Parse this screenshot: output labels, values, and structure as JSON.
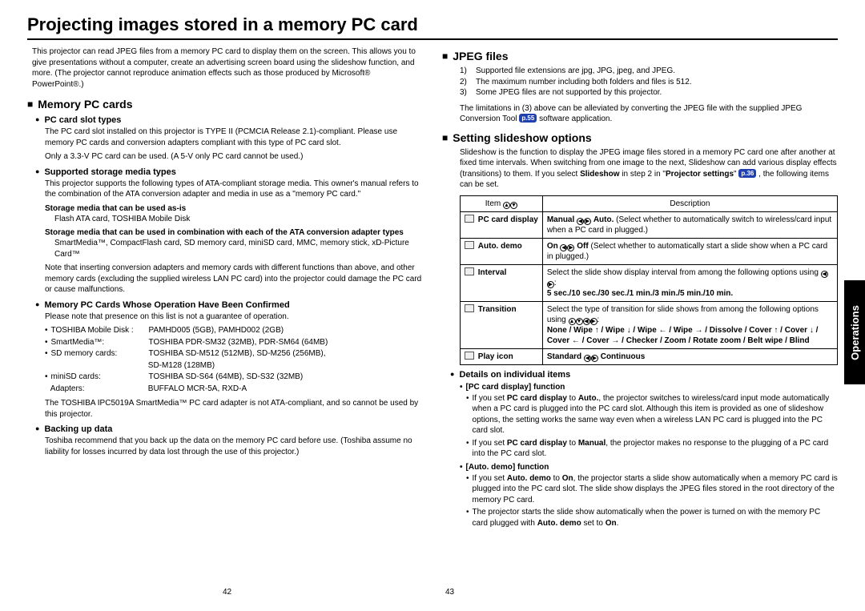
{
  "title": "Projecting images stored in a memory PC card",
  "intro": "This projector can read JPEG files from a memory PC card to display them on the screen. This allows you to give presentations without a computer, create an advertising screen board using the slideshow function, and more. (The projector cannot reproduce animation effects such as those produced by Microsoft® PowerPoint®.)",
  "sections": {
    "memory": "Memory PC cards",
    "jpeg": "JPEG files",
    "slideshow": "Setting slideshow options"
  },
  "sub": {
    "slot": "PC card slot types",
    "storage": "Supported storage media types",
    "confirmed": "Memory PC Cards Whose Operation Have Been Confirmed",
    "backup": "Backing up data",
    "details": "Details on individual items"
  },
  "slot_text": "The PC card slot installed on this projector is TYPE II (PCMCIA Release 2.1)-compliant. Please use memory PC cards and conversion adapters compliant with this type of PC card slot.",
  "slot_note": "Only a 3.3-V PC card can be used. (A 5-V only PC card cannot be used.)",
  "storage_text": "This projector supports the following types of ATA-compliant storage media. This owner's manual refers to the combination of the ATA conversion adapter and media in use as a \"memory PC card.\"",
  "storage_asis_title": "Storage media that can be used as-is",
  "storage_asis_body": "Flash ATA card, TOSHIBA Mobile Disk",
  "storage_combo_title": "Storage media that can be used in combination with each of the ATA conversion adapter types",
  "storage_combo_body": "SmartMedia™, CompactFlash card, SD memory card, miniSD card, MMC, memory stick, xD-Picture Card™",
  "storage_note": "Note that inserting conversion adapters and memory cards with different functions than above, and other memory cards (excluding the supplied wireless LAN PC card) into the projector could damage the PC card or cause malfunctions.",
  "confirmed_intro": "Please note that presence on this list is not a guarantee of operation.",
  "confirmed_rows": [
    {
      "label": "TOSHIBA Mobile Disk :",
      "value": "PAMHD005 (5GB), PAMHD002 (2GB)"
    },
    {
      "label": "SmartMedia™:",
      "value": "TOSHIBA PDR-SM32 (32MB), PDR-SM64 (64MB)"
    },
    {
      "label": "SD memory cards:",
      "value": "TOSHIBA SD-M512 (512MB), SD-M256 (256MB),"
    },
    {
      "label": "",
      "value": "SD-M128 (128MB)"
    },
    {
      "label": "miniSD cards:",
      "value": "TOSHIBA SD-S64 (64MB), SD-S32 (32MB)"
    },
    {
      "label": "Adapters:",
      "value": "BUFFALO MCR-5A, RXD-A"
    }
  ],
  "confirmed_note": "The TOSHIBA IPC5019A SmartMedia™ PC card adapter is not ATA-compliant, and so cannot be used by this projector.",
  "backup_text": "Toshiba recommend that you back up the data on the memory PC card before use. (Toshiba assume no liability for losses incurred by data lost through the use of this projector.)",
  "jpeg_list": [
    {
      "n": "1)",
      "t": "Supported file extensions are jpg, JPG, jpeg, and JPEG."
    },
    {
      "n": "2)",
      "t": "The maximum number including both folders and files is 512."
    },
    {
      "n": "3)",
      "t": "Some JPEG files are not supported by this projector."
    }
  ],
  "jpeg_post_a": "The limitations in (3) above can be alleviated by converting the JPEG file with the supplied JPEG Conversion Tool ",
  "jpeg_post_ref": "p.55",
  "jpeg_post_b": " software application.",
  "slideshow_intro_a": "Slideshow is the function to display the JPEG image files stored in a memory PC card one after another at fixed time intervals. When switching from one image to the next, Slideshow can add various display effects (transitions) to them. If you select ",
  "slideshow_intro_bold": "Slideshow",
  "slideshow_intro_b": " in step 2 in \"",
  "slideshow_intro_bold2": "Projector settings",
  "slideshow_intro_c": "\" ",
  "slideshow_intro_ref": "p.36",
  "slideshow_intro_d": " , the following items can be set.",
  "table": {
    "header_item": "Item",
    "header_desc": "Description",
    "rows": [
      {
        "item": "PC card display",
        "desc_html": "<b>Manual</b> <span class='arrowcircle'>◀</span><span class='arrowcircle'>▶</span> <b>Auto.</b>  (Select whether to automatically switch to wireless/card input when a PC card in plugged.)"
      },
      {
        "item": "Auto. demo",
        "desc_html": "<b>On</b> <span class='arrowcircle'>◀</span><span class='arrowcircle'>▶</span> <b>Off</b>  (Select whether to automatically start a slide show when a PC card in plugged.)"
      },
      {
        "item": "Interval",
        "desc_html": "Select the slide show display interval from among the following options using <span class='arrowcircle'>◀</span><span class='arrowcircle'>▶</span>:<br><b>5 sec./10 sec./30 sec./1 min./3 min./5 min./10 min.</b>"
      },
      {
        "item": "Transition",
        "desc_html": "Select the type of transition for slide shows from among the following options using <span class='arrowcircle'>▲</span><span class='arrowcircle'>▼</span><span class='arrowcircle'>◀</span><span class='arrowcircle'>▶</span>:<br><b>None / Wipe ↑  / Wipe ↓  / Wipe ←  / Wipe →  /  Dissolve / Cover ↑ / Cover ↓ / Cover ← / Cover → /   Checker / Zoom / Rotate zoom / Belt wipe / Blind</b>"
      },
      {
        "item": "Play icon",
        "desc_html": "<b>Standard</b> <span class='arrowcircle'>◀</span><span class='arrowcircle'>▶</span> <b>Continuous</b>"
      }
    ]
  },
  "details": {
    "pc_head": "[PC card display] function",
    "pc_items": [
      "If you set <b>PC card display</b> to <b>Auto.</b>, the projector switches to wireless/card input mode automatically when a PC card is plugged into the PC card slot. Although this item is provided as one of slideshow options, the setting works the same way even when a wireless LAN PC card is plugged into the PC card slot.",
      "If you set <b>PC card display</b> to <b>Manual</b>, the projector makes no response to the plugging of a PC card into the PC card slot."
    ],
    "auto_head": "[Auto. demo] function",
    "auto_items": [
      "If you set <b>Auto. demo</b> to <b>On</b>, the projector starts a slide show automatically when a memory PC card is plugged into the PC card slot. The slide show displays the JPEG files stored in the root directory of the memory PC card.",
      "The projector starts the slide show automatically when the power is turned on with the memory PC card plugged with <b>Auto. demo</b> set to <b>On</b>."
    ]
  },
  "sidetab": "Operations",
  "page_left": "42",
  "page_right": "43"
}
